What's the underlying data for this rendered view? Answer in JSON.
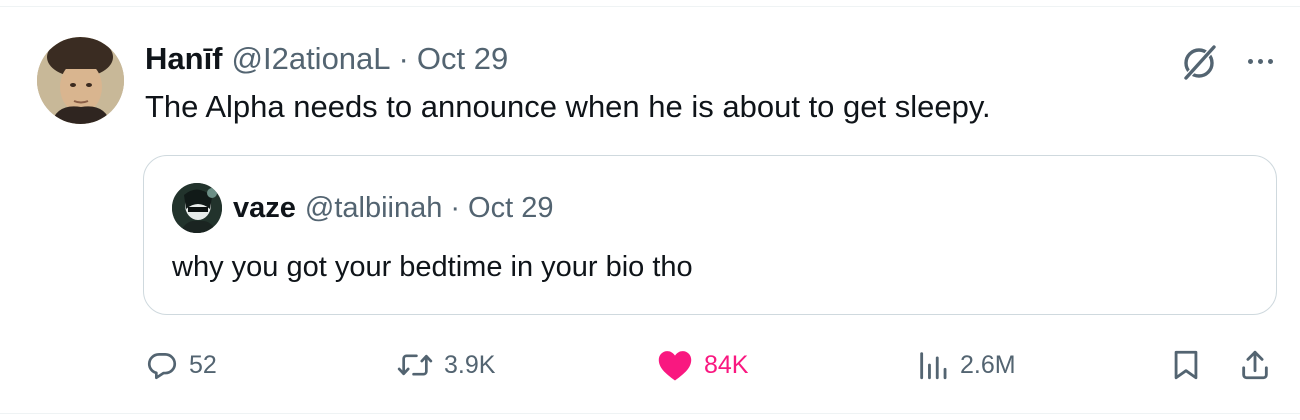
{
  "tweet": {
    "author_name": "Hanīf",
    "author_handle": "@I2ationaL",
    "separator": "·",
    "date": "Oct 29",
    "text": "The Alpha needs to announce when he is about to get sleepy.",
    "avatar_icon": "avatar-photo"
  },
  "quote": {
    "author_name": "vaze",
    "author_handle": "@talbiinah",
    "separator": "·",
    "date": "Oct 29",
    "text": "why you got your bedtime in your bio tho",
    "avatar_icon": "avatar-photo"
  },
  "actions": {
    "replies": "52",
    "retweets": "3.9K",
    "likes": "84K",
    "views": "2.6M",
    "liked": true
  },
  "icons": {
    "grok": "grok-icon",
    "more": "more-icon",
    "reply": "reply-icon",
    "retweet": "retweet-icon",
    "like": "heart-icon",
    "views": "views-icon",
    "bookmark": "bookmark-icon",
    "share": "share-icon"
  },
  "colors": {
    "text_primary": "#0f1419",
    "text_secondary": "#536471",
    "like_active": "#f91880",
    "border": "#cfd9de"
  }
}
